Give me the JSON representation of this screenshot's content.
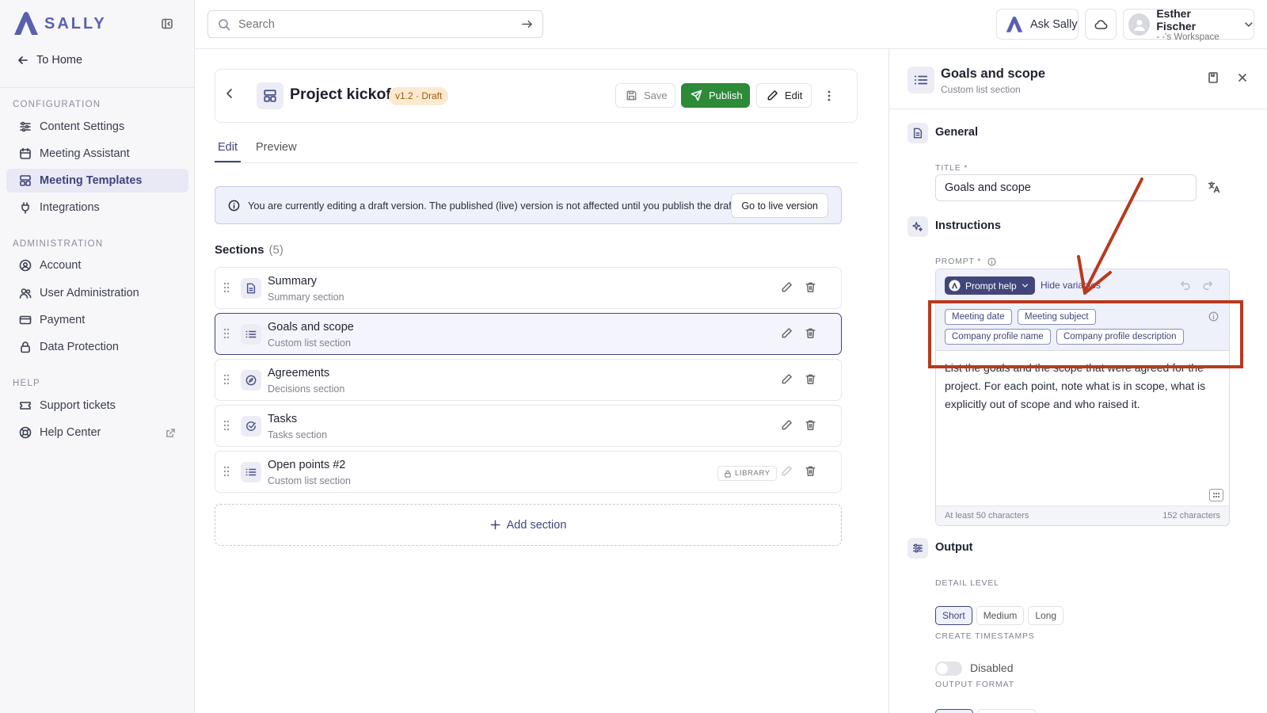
{
  "app": {
    "brand": "SALLY",
    "brand_color": "#5b5fb0",
    "accent": "#41457a",
    "publish_color": "#2c8a38"
  },
  "sidebar": {
    "to_home": "To Home",
    "configuration_label": "CONFIGURATION",
    "administration_label": "ADMINISTRATION",
    "help_label": "HELP",
    "configuration": [
      {
        "label": "Content Settings",
        "icon": "sliders-icon"
      },
      {
        "label": "Meeting Assistant",
        "icon": "calendar-icon"
      },
      {
        "label": "Meeting Templates",
        "icon": "template-icon",
        "active": true
      },
      {
        "label": "Integrations",
        "icon": "plug-icon"
      }
    ],
    "administration": [
      {
        "label": "Account",
        "icon": "user-circle-icon"
      },
      {
        "label": "User Administration",
        "icon": "users-icon"
      },
      {
        "label": "Payment",
        "icon": "credit-card-icon"
      },
      {
        "label": "Data Protection",
        "icon": "lock-icon"
      }
    ],
    "help": [
      {
        "label": "Support tickets",
        "icon": "ticket-icon"
      },
      {
        "label": "Help Center",
        "icon": "lifebuoy-icon"
      }
    ]
  },
  "topbar": {
    "search_placeholder": "Search",
    "ask_label": "Ask Sally",
    "user_name": "Esther Fischer",
    "user_workspace": "- -'s Workspace"
  },
  "template": {
    "title": "Project kickoff",
    "version": "v1.2 · Draft",
    "save_label": "Save",
    "publish_label": "Publish",
    "edit_label": "Edit",
    "tabs": [
      "Edit",
      "Preview"
    ],
    "banner_text": "You are currently editing a draft version. The published (live) version is not affected until you publish the draft.",
    "banner_button": "Go to live version",
    "sections_title": "Sections",
    "sections_count": "(5)",
    "sections": [
      {
        "name": "Summary",
        "type": "Summary section",
        "icon": "document-icon"
      },
      {
        "name": "Goals and scope",
        "type": "Custom list section",
        "icon": "list-icon",
        "selected": true
      },
      {
        "name": "Agreements",
        "type": "Decisions section",
        "icon": "compass-icon"
      },
      {
        "name": "Tasks",
        "type": "Tasks section",
        "icon": "check-circle-icon"
      },
      {
        "name": "Open points #2",
        "type": "Custom list section",
        "icon": "list-icon",
        "badge": "LIBRARY"
      }
    ],
    "add_section_label": "Add section"
  },
  "panel": {
    "title": "Goals and scope",
    "subtitle": "Custom list section",
    "general_label": "General",
    "title_field_label": "TITLE *",
    "title_value": "Goals and scope",
    "instructions_label": "Instructions",
    "prompt_label": "PROMPT *",
    "prompt_help_label": "Prompt help",
    "hide_variables_label": "Hide variables",
    "variables": [
      "Meeting date",
      "Meeting subject",
      "Company profile name",
      "Company profile description"
    ],
    "prompt_text": "List the goals and the scope that were agreed for the project. For each point, note what is in scope, what is explicitly out of scope and who raised it.",
    "min_chars": "At least 50 characters",
    "char_count": "152 characters",
    "output_label": "Output",
    "detail_level_label": "DETAIL LEVEL",
    "detail_levels": [
      "Short",
      "Medium",
      "Long"
    ],
    "timestamps_label": "CREATE TIMESTAMPS",
    "timestamps_value": "Disabled",
    "output_format_label": "OUTPUT FORMAT"
  },
  "annotation": {
    "color": "#b8391d"
  }
}
